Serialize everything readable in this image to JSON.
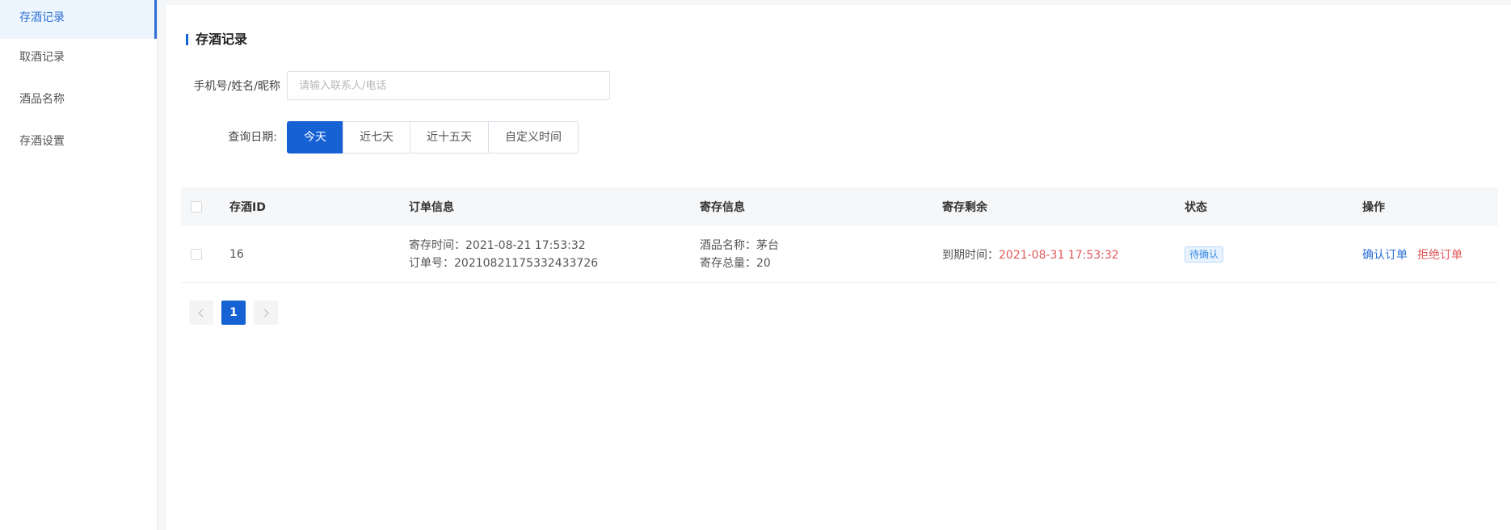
{
  "sidebar": {
    "items": [
      {
        "label": "存酒记录"
      },
      {
        "label": "取酒记录"
      },
      {
        "label": "酒品名称"
      },
      {
        "label": "存酒设置"
      }
    ]
  },
  "page": {
    "title": "存酒记录"
  },
  "filters": {
    "search_label": "手机号/姓名/昵称",
    "search_placeholder": "请输入联系人/电话",
    "search_value": "",
    "date_label": "查询日期:",
    "date_options": [
      {
        "label": "今天",
        "selected": true
      },
      {
        "label": "近七天",
        "selected": false
      },
      {
        "label": "近十五天",
        "selected": false
      },
      {
        "label": "自定义时间",
        "selected": false
      }
    ]
  },
  "table": {
    "headers": {
      "id": "存酒ID",
      "order": "订单信息",
      "store": "寄存信息",
      "remain": "寄存剩余",
      "status": "状态",
      "ops": "操作"
    },
    "rows": [
      {
        "id": "16",
        "order_time": "寄存时间：2021-08-21 17:53:32",
        "order_no": "订单号：20210821175332433726",
        "wine_name": "酒品名称：茅台",
        "total": "寄存总量：20",
        "expire_label": "到期时间：",
        "expire_value": "2021-08-31 17:53:32",
        "status": "待确认",
        "op_confirm": "确认订单",
        "op_reject": "拒绝订单"
      }
    ]
  },
  "pagination": {
    "current": "1"
  },
  "colors": {
    "accent": "#1661d4",
    "danger": "#e05858",
    "badge": "#3e8fe2"
  }
}
